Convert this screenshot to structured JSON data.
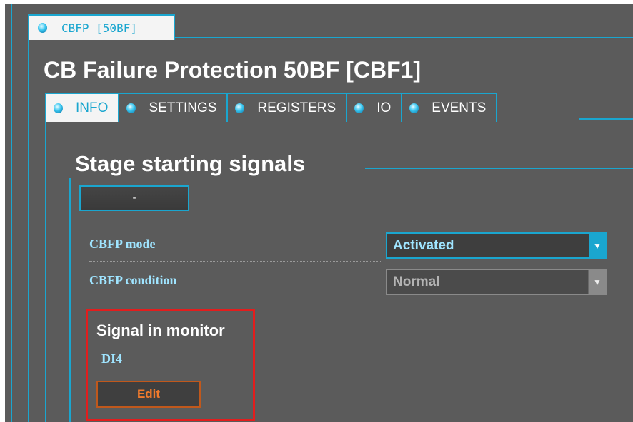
{
  "window_tab": {
    "label": "CBFP [50BF]",
    "icon": "status-led-icon"
  },
  "page_title": "CB Failure Protection 50BF [CBF1]",
  "tabs": [
    {
      "label": "INFO",
      "active": true
    },
    {
      "label": "SETTINGS",
      "active": false
    },
    {
      "label": "REGISTERS",
      "active": false
    },
    {
      "label": "IO",
      "active": false
    },
    {
      "label": "EVENTS",
      "active": false
    }
  ],
  "section": {
    "title": "Stage starting signals"
  },
  "dash_button": {
    "label": "-"
  },
  "fields": {
    "mode": {
      "label": "CBFP mode",
      "value": "Activated",
      "enabled": true
    },
    "condition": {
      "label": "CBFP condition",
      "value": "Normal",
      "enabled": false
    }
  },
  "monitor": {
    "label": "Signal in monitor",
    "value": "DI4",
    "edit_label": "Edit",
    "highlight_color": "#e31d1d"
  },
  "colors": {
    "accent": "#1aa6cf",
    "background": "#5b5b5b",
    "label_text": "#9fe4ff",
    "edit_text": "#f07a2c"
  }
}
